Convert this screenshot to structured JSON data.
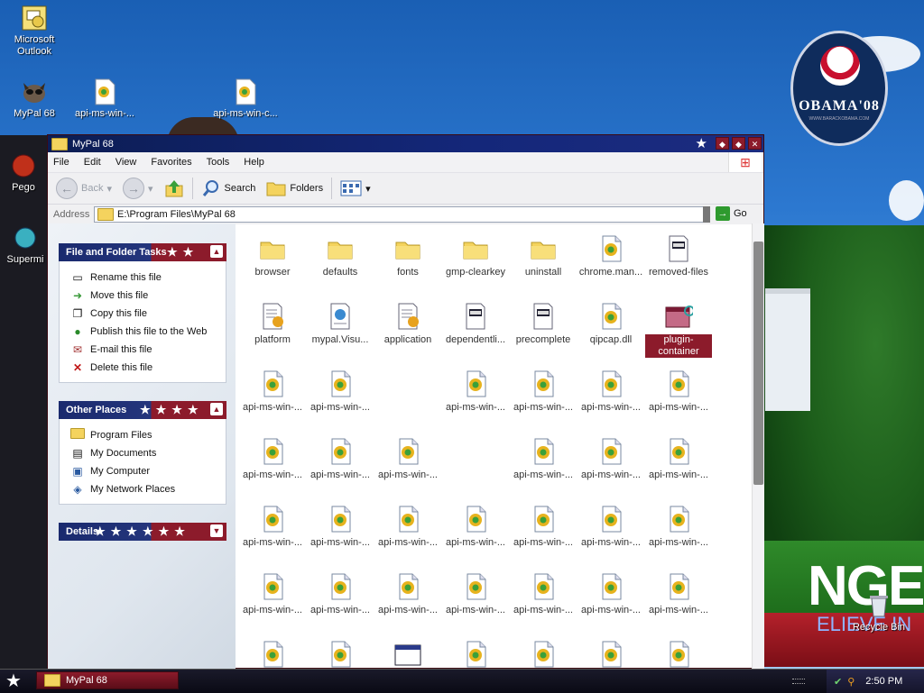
{
  "desktop": {
    "icons": [
      {
        "label": "Microsoft Outlook",
        "icon": "outlook-icon"
      },
      {
        "label": "MyPal 68",
        "icon": "mypal-icon"
      },
      {
        "label": "api-ms-win-...",
        "icon": "dll-icon"
      },
      {
        "label": "api-ms-win-c...",
        "icon": "dll-icon"
      },
      {
        "label": "Pego",
        "icon": "app-icon"
      },
      {
        "label": "Supermi",
        "icon": "app-icon"
      },
      {
        "label": "Recycle Bin",
        "icon": "recycle-bin-icon"
      }
    ],
    "badge": {
      "text": "OBAMA'08",
      "small": "WWW.BARACKOBAMA.COM"
    },
    "wallpaper_text": {
      "big": "NGE",
      "small": "ELIEVE IN"
    }
  },
  "window": {
    "title": "MyPal 68",
    "menu": [
      "File",
      "Edit",
      "View",
      "Favorites",
      "Tools",
      "Help"
    ],
    "toolbar": {
      "back": "Back",
      "search": "Search",
      "folders": "Folders"
    },
    "address": {
      "label": "Address",
      "value": "E:\\Program Files\\MyPal 68",
      "go": "Go"
    },
    "panels": {
      "file_tasks": {
        "title": "File and Folder Tasks",
        "items": [
          "Rename this file",
          "Move this file",
          "Copy this file",
          "Publish this file to the Web",
          "E-mail this file",
          "Delete this file"
        ]
      },
      "other_places": {
        "title": "Other Places",
        "items": [
          "Program Files",
          "My Documents",
          "My Computer",
          "My Network Places"
        ]
      },
      "details": {
        "title": "Details"
      }
    },
    "files": [
      {
        "name": "browser",
        "type": "folder"
      },
      {
        "name": "defaults",
        "type": "folder"
      },
      {
        "name": "fonts",
        "type": "folder"
      },
      {
        "name": "gmp-clearkey",
        "type": "folder"
      },
      {
        "name": "uninstall",
        "type": "folder"
      },
      {
        "name": "chrome.man...",
        "type": "dll"
      },
      {
        "name": "removed-files",
        "type": "doc"
      },
      {
        "name": "platform",
        "type": "ini"
      },
      {
        "name": "mypal.Visu...",
        "type": "manifest"
      },
      {
        "name": "application",
        "type": "ini"
      },
      {
        "name": "dependentli...",
        "type": "doc"
      },
      {
        "name": "precomplete",
        "type": "doc"
      },
      {
        "name": "qipcap.dll",
        "type": "dll"
      },
      {
        "name": "plugin-container",
        "type": "exe",
        "selected": true
      },
      {
        "name": "api-ms-win-...",
        "type": "dll"
      },
      {
        "name": "api-ms-win-...",
        "type": "dll"
      },
      {
        "name": "",
        "type": "empty"
      },
      {
        "name": "api-ms-win-...",
        "type": "dll"
      },
      {
        "name": "api-ms-win-...",
        "type": "dll"
      },
      {
        "name": "api-ms-win-...",
        "type": "dll"
      },
      {
        "name": "api-ms-win-...",
        "type": "dll"
      },
      {
        "name": "api-ms-win-...",
        "type": "dll"
      },
      {
        "name": "api-ms-win-...",
        "type": "dll"
      },
      {
        "name": "api-ms-win-...",
        "type": "dll"
      },
      {
        "name": "",
        "type": "empty"
      },
      {
        "name": "api-ms-win-...",
        "type": "dll"
      },
      {
        "name": "api-ms-win-...",
        "type": "dll"
      },
      {
        "name": "api-ms-win-...",
        "type": "dll"
      },
      {
        "name": "api-ms-win-...",
        "type": "dll"
      },
      {
        "name": "api-ms-win-...",
        "type": "dll"
      },
      {
        "name": "api-ms-win-...",
        "type": "dll"
      },
      {
        "name": "api-ms-win-...",
        "type": "dll"
      },
      {
        "name": "api-ms-win-...",
        "type": "dll"
      },
      {
        "name": "api-ms-win-...",
        "type": "dll"
      },
      {
        "name": "api-ms-win-...",
        "type": "dll"
      },
      {
        "name": "api-ms-win-...",
        "type": "dll"
      },
      {
        "name": "api-ms-win-...",
        "type": "dll"
      },
      {
        "name": "api-ms-win-...",
        "type": "dll"
      },
      {
        "name": "api-ms-win-...",
        "type": "dll"
      },
      {
        "name": "api-ms-win-...",
        "type": "dll"
      },
      {
        "name": "api-ms-win-...",
        "type": "dll"
      },
      {
        "name": "api-ms-win-...",
        "type": "dll"
      },
      {
        "name": "",
        "type": "dll"
      },
      {
        "name": "",
        "type": "dll"
      },
      {
        "name": "",
        "type": "window"
      },
      {
        "name": "",
        "type": "dll"
      },
      {
        "name": "",
        "type": "dll"
      },
      {
        "name": "",
        "type": "dll"
      },
      {
        "name": "",
        "type": "dll"
      }
    ]
  },
  "taskbar": {
    "task": "MyPal 68",
    "clock": "2:50 PM"
  },
  "colors": {
    "accent": "#8c1b2b",
    "title": "#14277a"
  }
}
